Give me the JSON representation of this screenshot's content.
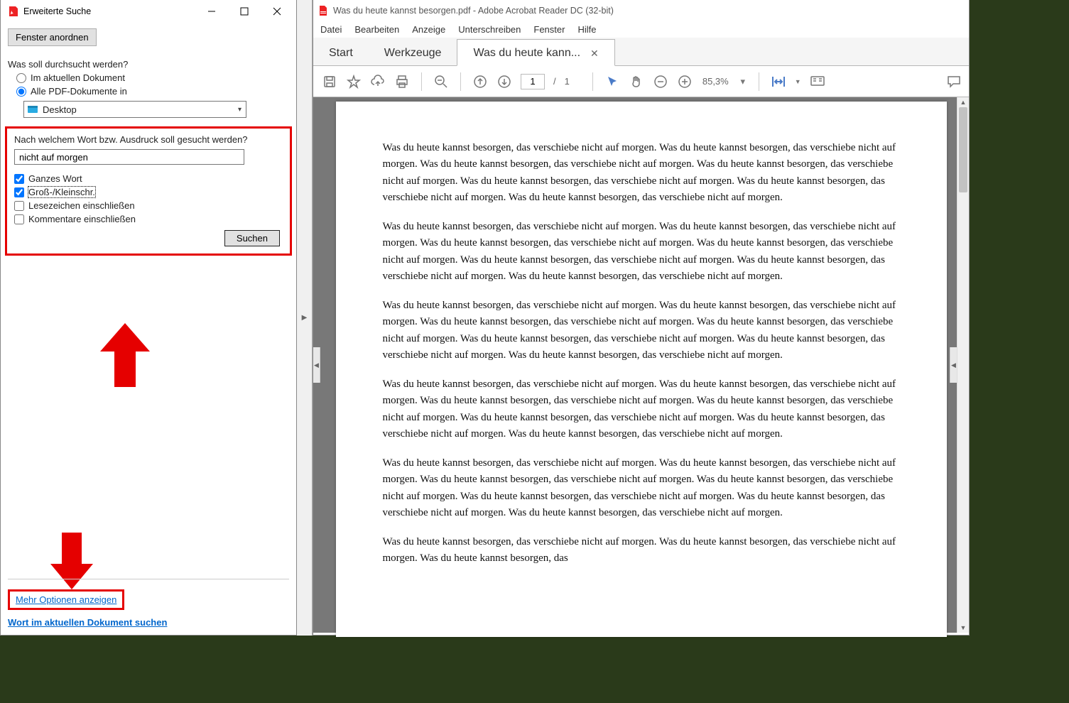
{
  "search_window": {
    "title": "Erweiterte Suche",
    "arrange_button": "Fenster anordnen",
    "scope_label": "Was soll durchsucht werden?",
    "radio_current": "Im aktuellen Dokument",
    "radio_all": "Alle PDF-Dokumente in",
    "folder_dropdown": "Desktop",
    "query_label": "Nach welchem Wort bzw. Ausdruck soll gesucht werden?",
    "query_value": "nicht auf morgen",
    "cb_whole_word": "Ganzes Wort",
    "cb_case": "Groß-/Kleinschr.",
    "cb_bookmarks": "Lesezeichen einschließen",
    "cb_comments": "Kommentare einschließen",
    "search_button": "Suchen",
    "more_options": "Mehr Optionen anzeigen",
    "find_in_doc": "Wort im aktuellen Dokument suchen"
  },
  "main_window": {
    "title": "Was du heute kannst besorgen.pdf - Adobe Acrobat Reader DC (32-bit)",
    "menu": {
      "file": "Datei",
      "edit": "Bearbeiten",
      "view": "Anzeige",
      "sign": "Unterschreiben",
      "window": "Fenster",
      "help": "Hilfe"
    },
    "tabs": {
      "start": "Start",
      "tools": "Werkzeuge",
      "doc": "Was du heute kann..."
    },
    "page_current": "1",
    "page_sep": "/",
    "page_total": "1",
    "zoom": "85,3%",
    "paragraph": "Was du heute kannst besorgen, das verschiebe nicht auf morgen. Was du heute kannst besorgen, das verschiebe nicht auf morgen. Was du heute kannst besorgen, das verschiebe nicht auf morgen. Was du heute kannst besorgen, das verschiebe nicht auf morgen. Was du heute kannst besorgen, das verschiebe nicht auf morgen. Was du heute kannst besorgen, das verschiebe nicht auf morgen. Was du heute kannst besorgen, das verschiebe nicht auf morgen.",
    "paragraph_last": "Was du heute kannst besorgen, das verschiebe nicht auf morgen. Was du heute kannst besorgen, das verschiebe nicht auf morgen. Was du heute kannst besorgen, das"
  },
  "colors": {
    "highlight_red": "#e50000",
    "link": "#0066cc"
  }
}
